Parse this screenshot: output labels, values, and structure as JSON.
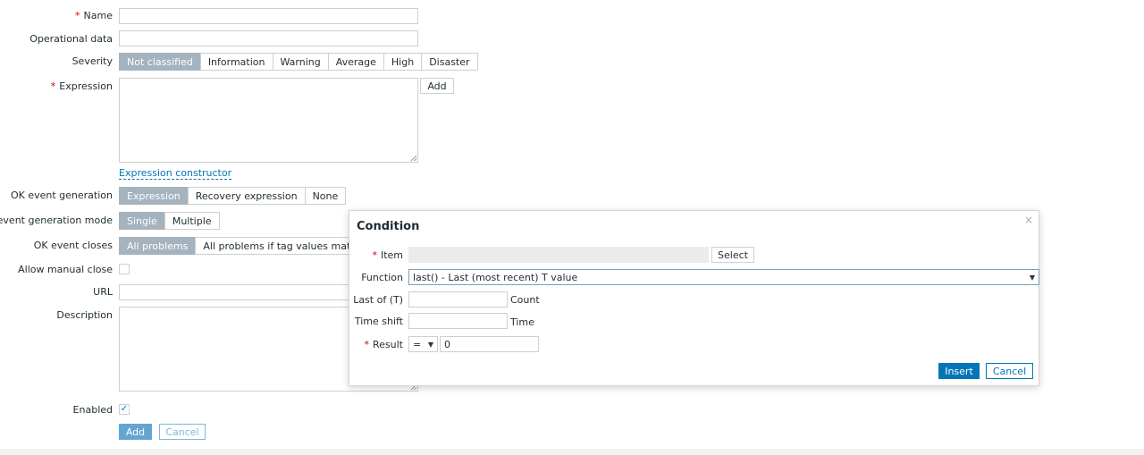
{
  "form": {
    "name_label": "Name",
    "opdata_label": "Operational data",
    "severity_label": "Severity",
    "severity_options": [
      "Not classified",
      "Information",
      "Warning",
      "Average",
      "High",
      "Disaster"
    ],
    "expression_label": "Expression",
    "expression_add": "Add",
    "expression_constructor": "Expression constructor",
    "ok_event_generation_label": "OK event generation",
    "ok_event_generation_options": [
      "Expression",
      "Recovery expression",
      "None"
    ],
    "problem_mode_label": "PROBLEM event generation mode",
    "problem_mode_options": [
      "Single",
      "Multiple"
    ],
    "ok_event_closes_label": "OK event closes",
    "ok_event_closes_options": [
      "All problems",
      "All problems if tag values match"
    ],
    "allow_manual_close_label": "Allow manual close",
    "url_label": "URL",
    "description_label": "Description",
    "enabled_label": "Enabled",
    "enabled_check": "✓",
    "add_button": "Add",
    "cancel_button": "Cancel",
    "required_mark": "*"
  },
  "dialog": {
    "title": "Condition",
    "close": "×",
    "item_label": "Item",
    "item_value": "",
    "select_button": "Select",
    "function_label": "Function",
    "function_value": "last() - Last (most recent) T value",
    "last_of_label": "Last of (T)",
    "last_of_value": "",
    "last_of_unit": "Count",
    "time_shift_label": "Time shift",
    "time_shift_value": "",
    "time_shift_unit": "Time",
    "result_label": "Result",
    "result_operator": "=",
    "result_value": "0",
    "insert_button": "Insert",
    "cancel_button": "Cancel"
  },
  "colors": {
    "accent": "#0275b8",
    "segment_active": "#a5b3be",
    "required": "#d40000"
  }
}
